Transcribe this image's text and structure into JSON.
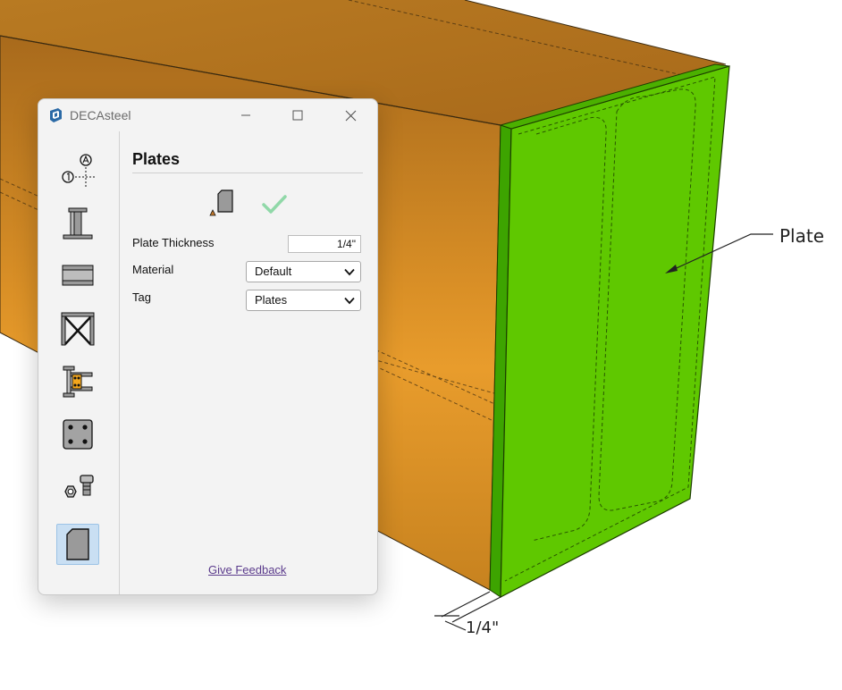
{
  "scene": {
    "plate_callout": "Plate",
    "dimension_label": "1/4\"",
    "colors": {
      "beam": "#C8861F",
      "plate": "#5FC800"
    }
  },
  "window": {
    "title": "DECAsteel",
    "app_icon": "sketchup-icon",
    "controls": [
      "minimize-icon",
      "maximize-icon",
      "close-icon"
    ]
  },
  "sidebar": {
    "tools": [
      {
        "icon": "grid-axis-icon",
        "active": false
      },
      {
        "icon": "column-icon",
        "active": false
      },
      {
        "icon": "beam-icon",
        "active": false
      },
      {
        "icon": "truss-bracing-icon",
        "active": false
      },
      {
        "icon": "connection-icon",
        "active": false
      },
      {
        "icon": "base-plate-bolts-icon",
        "active": false
      },
      {
        "icon": "bolt-nut-icon",
        "active": false
      },
      {
        "icon": "plate-icon",
        "active": true
      }
    ]
  },
  "panel": {
    "heading": "Plates",
    "fields": {
      "thickness_label": "Plate Thickness",
      "thickness_value": "1/4\"",
      "material_label": "Material",
      "material_value": "Default",
      "tag_label": "Tag",
      "tag_value": "Plates"
    },
    "feedback_link": "Give Feedback",
    "accent_color": "#90D8A8"
  }
}
